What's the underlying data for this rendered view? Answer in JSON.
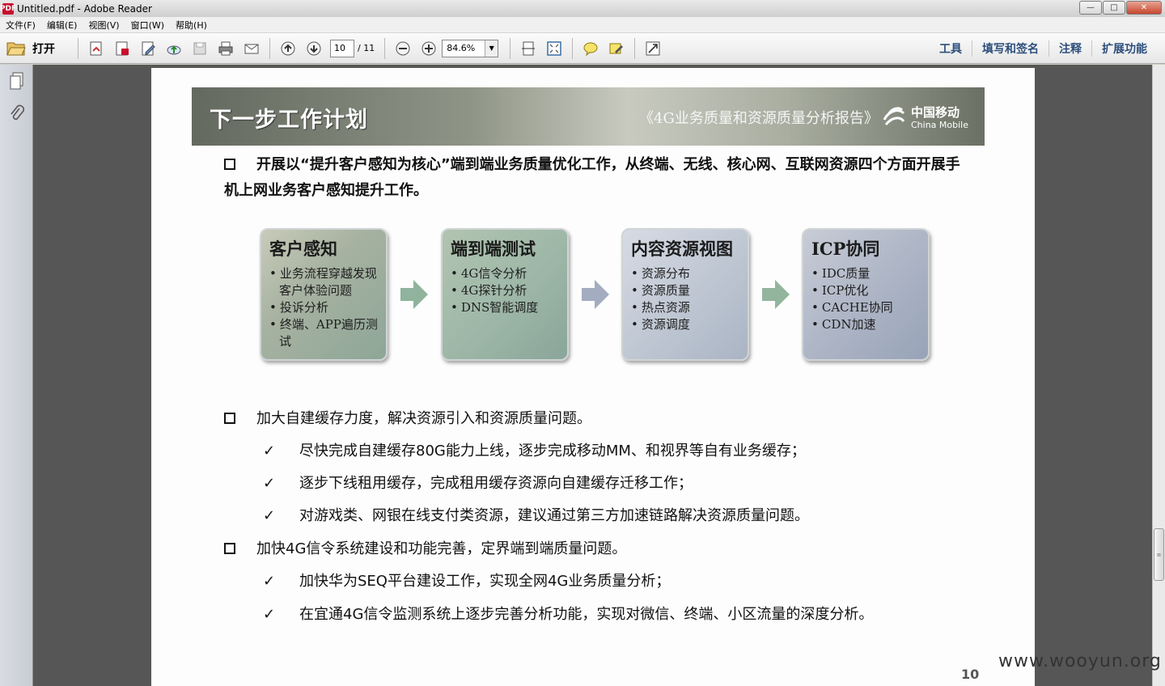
{
  "window": {
    "title": "Untitled.pdf - Adobe Reader",
    "app_icon": "PDF",
    "controls": {
      "minimize": "—",
      "maximize": "□",
      "close": "✕"
    }
  },
  "menu": [
    "文件(F)",
    "编辑(E)",
    "视图(V)",
    "窗口(W)",
    "帮助(H)"
  ],
  "toolbar": {
    "open_label": "打开",
    "page_current": "10",
    "page_total": "/ 11",
    "zoom": "84.6%",
    "right_tools": [
      "工具",
      "填写和签名",
      "注释",
      "扩展功能"
    ]
  },
  "page": {
    "banner_title": "下一步工作计划",
    "banner_subtitle": "《4G业务质量和资源质量分析报告》",
    "logo_cn": "中国移动",
    "logo_en": "China Mobile",
    "headline": "开展以“提升客户感知为核心”端到端业务质量优化工作，从终端、无线、核心网、互联网资源四个方面开展手机上网业务客户感知提升工作。",
    "flow": [
      {
        "title": "客户感知",
        "items": [
          "业务流程穿越发现客户体验问题",
          "投诉分析",
          "终端、APP遍历测试"
        ]
      },
      {
        "title": "端到端测试",
        "items": [
          "4G信令分析",
          "4G探针分析",
          "DNS智能调度"
        ]
      },
      {
        "title": "内容资源视图",
        "items": [
          "资源分布",
          "资源质量",
          "热点资源",
          "资源调度"
        ]
      },
      {
        "title": "ICP协同",
        "items": [
          "IDC质量",
          "ICP优化",
          "CACHE协同",
          "CDN加速"
        ]
      }
    ],
    "sections": [
      {
        "title": "加大自建缓存力度，解决资源引入和资源质量问题。",
        "items": [
          "尽快完成自建缓存80G能力上线，逐步完成移动MM、和视界等自有业务缓存；",
          "逐步下线租用缓存，完成租用缓存资源向自建缓存迁移工作；",
          "对游戏类、网银在线支付类资源，建议通过第三方加速链路解决资源质量问题。"
        ]
      },
      {
        "title": "加快4G信令系统建设和功能完善，定界端到端质量问题。",
        "items": [
          "加快华为SEQ平台建设工作，实现全网4G业务质量分析；",
          "在宜通4G信令监测系统上逐步完善分析功能，实现对微信、终端、小区流量的深度分析。"
        ]
      }
    ],
    "check_mark": "✓",
    "page_number": "10"
  },
  "watermark": "www.wooyun.org"
}
